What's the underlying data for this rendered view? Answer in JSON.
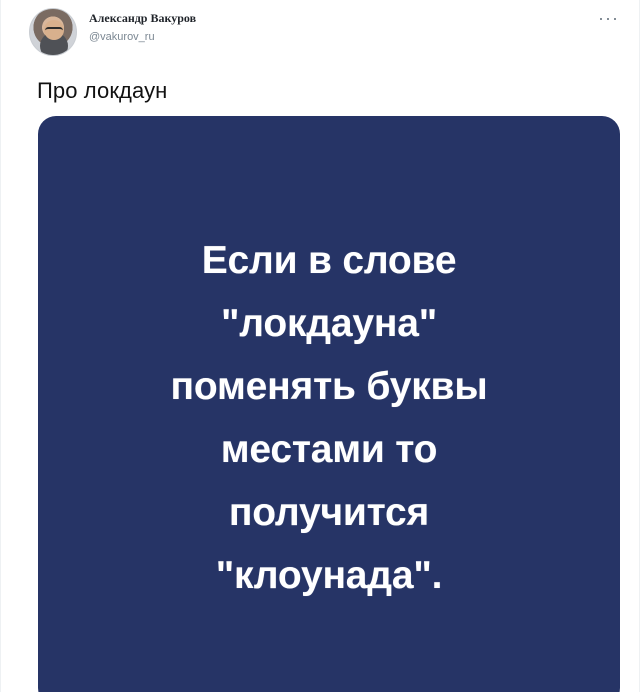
{
  "author": {
    "name": "Александр Вакуров",
    "handle": "@vakurov_ru"
  },
  "more_icon": "more-horizontal-icon",
  "tweet": {
    "text": "Про локдаун"
  },
  "media": {
    "lines": [
      "Если в слове",
      "\"локдауна\"",
      "поменять буквы",
      "местами то",
      "получится",
      "\"клоунада\"."
    ]
  },
  "colors": {
    "card_background": "#263466",
    "text_on_card": "#ffffff",
    "handle_text": "#7b8792"
  }
}
